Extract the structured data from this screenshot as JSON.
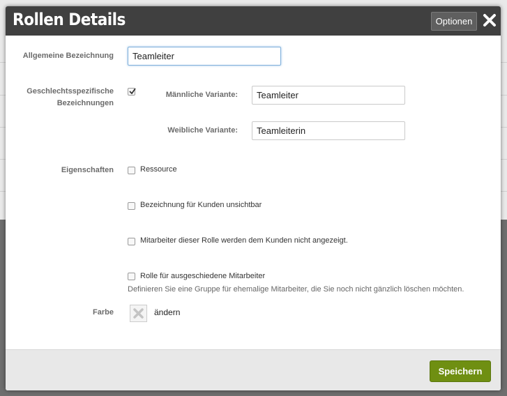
{
  "modal": {
    "title": "Rollen Details",
    "options_label": "Optionen",
    "close_icon": "close-icon"
  },
  "form": {
    "general_label": "Allgemeine Bezeichnung",
    "general_value": "Teamleiter",
    "gender_label_line1": "Geschlechtsspezifische",
    "gender_label_line2": "Bezeichnungen",
    "gender_checked": true,
    "male_label": "Männliche Variante:",
    "male_value": "Teamleiter",
    "female_label": "Weibliche Variante:",
    "female_value": "Teamleiterin",
    "properties_label": "Eigenschaften",
    "properties": [
      {
        "label": "Ressource",
        "checked": false
      },
      {
        "label": "Bezeichnung für Kunden unsichtbar",
        "checked": false
      },
      {
        "label": "Mitarbeiter dieser Rolle werden dem Kunden nicht angezeigt.",
        "checked": false
      },
      {
        "label": "Rolle für ausgeschiedene Mitarbeiter",
        "checked": false
      }
    ],
    "former_hint": "Definieren Sie eine Gruppe für ehemalige Mitarbeiter, die Sie noch nicht gänzlich löschen möchten.",
    "color_label": "Farbe",
    "color_change": "ändern"
  },
  "footer": {
    "save_label": "Speichern"
  },
  "colors": {
    "header": "#404040",
    "save_button": "#6f8f12",
    "footer": "#e8e8e8"
  }
}
